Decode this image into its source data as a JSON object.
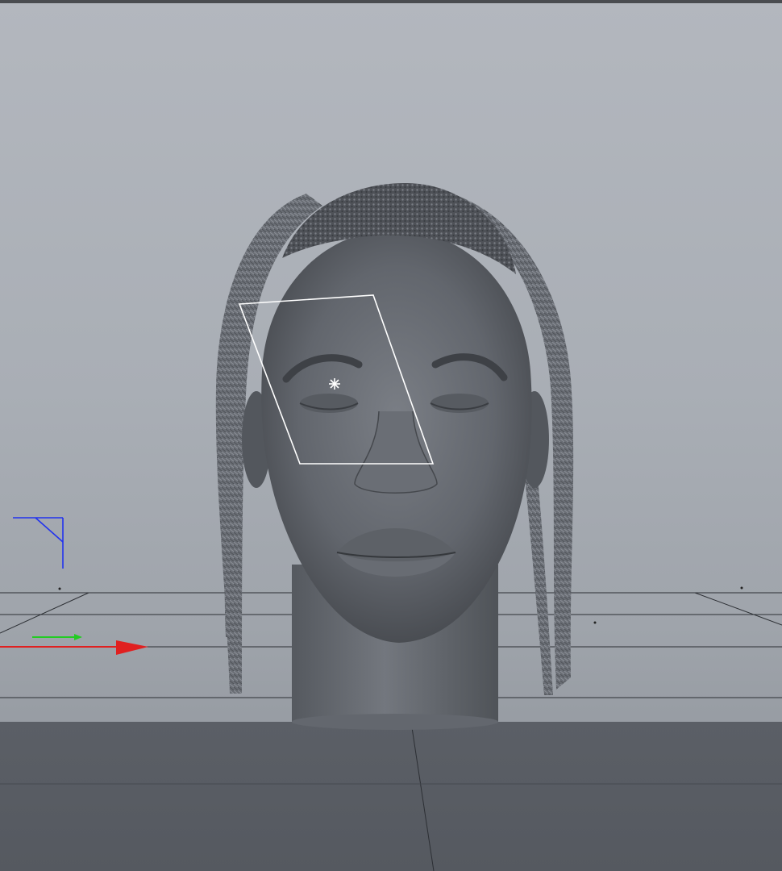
{
  "viewport": {
    "mode": "perspective",
    "background_color": "#a9aeb5",
    "floor_color": "#585c63",
    "grid_color": "#2c2f34"
  },
  "scene": {
    "objects": [
      {
        "name": "head-sculpt",
        "color": "#5f636a"
      },
      {
        "name": "hair-braids",
        "color": "#6c7077"
      },
      {
        "name": "pedestal-cylinder",
        "color": "#6a6e75"
      }
    ],
    "selection": {
      "object": "area-light",
      "outline_color": "#ffffff"
    }
  },
  "axis_gizmo": {
    "x_color": "#e02020",
    "y_color": "#22cc22",
    "z_color": "#2233ee"
  },
  "icons": [
    "light-icon",
    "axis-gizmo-icon",
    "camera-icon"
  ]
}
